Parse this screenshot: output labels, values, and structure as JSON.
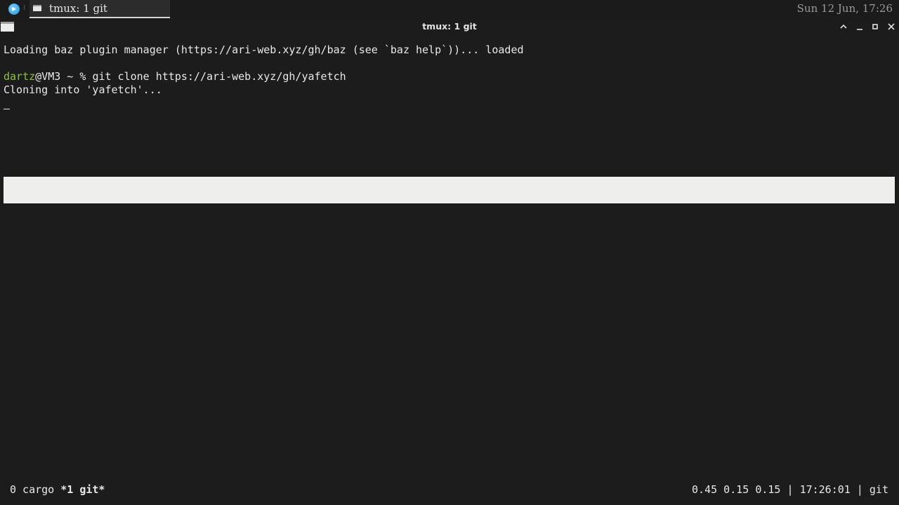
{
  "panel": {
    "launcher_icon": "app-launcher-icon",
    "task_window_title": "tmux: 1 git",
    "clock": "Sun 12 Jun, 17:26"
  },
  "window": {
    "title": "tmux: 1 git",
    "buttons": [
      "shade-up-icon",
      "minimize-icon",
      "maximize-icon",
      "close-icon"
    ]
  },
  "terminal": {
    "line1": "Loading baz plugin manager (https://ari-web.xyz/gh/baz (see `baz help`))... loaded",
    "prompt_user": "dartz",
    "prompt_rest": "@VM3 ~ % ",
    "command": "git clone https://ari-web.xyz/gh/yafetch",
    "line3": "Cloning into 'yafetch'..."
  },
  "tmux": {
    "windows": [
      {
        "label": "0 cargo",
        "active": false
      },
      {
        "label": "*1 git*",
        "active": true
      }
    ],
    "load": "0.45 0.15 0.15",
    "time": "17:26:01",
    "current": "git",
    "separator": " | "
  },
  "colors": {
    "background": "#1c1c1c",
    "foreground": "#e8e8e8",
    "user": "#8fbf3f"
  }
}
